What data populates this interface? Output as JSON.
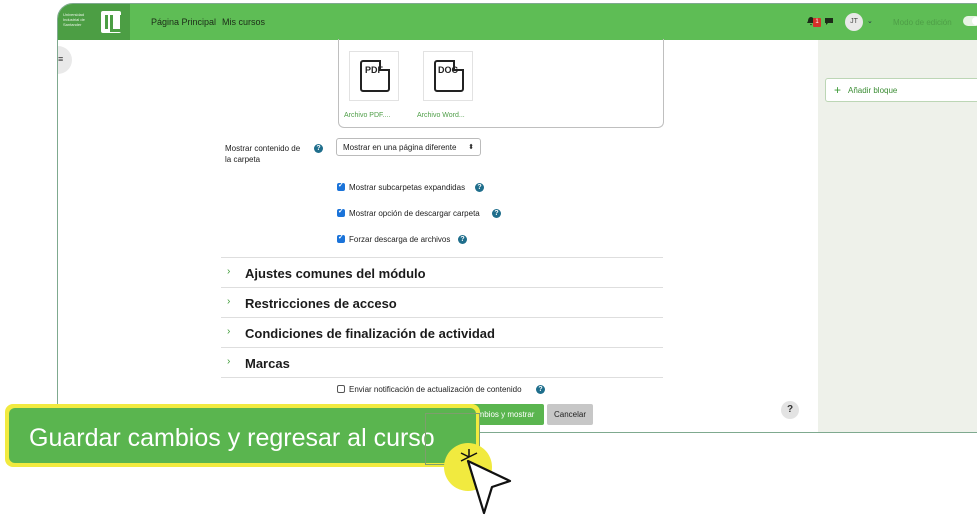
{
  "topbar": {
    "logo_text": "Universidad Industrial de Santander",
    "nav": [
      "Página Principal",
      "Mis cursos"
    ],
    "notification_count": "1",
    "avatar_initials": "JT",
    "edit_mode_label": "Modo de edición"
  },
  "files": [
    {
      "icon": "PDF",
      "name": "Archivo PDF...."
    },
    {
      "icon": "DOC",
      "name": "Archivo Word..."
    }
  ],
  "display": {
    "label": "Mostrar contenido de la carpeta",
    "select_value": "Mostrar en una página diferente"
  },
  "checkboxes": [
    {
      "label": "Mostrar subcarpetas expandidas",
      "checked": true
    },
    {
      "label": "Mostrar opción de descargar carpeta",
      "checked": true
    },
    {
      "label": "Forzar descarga de archivos",
      "checked": true
    }
  ],
  "sections": [
    "Ajustes comunes del módulo",
    "Restricciones de acceso",
    "Condiciones de finalización de actividad",
    "Marcas"
  ],
  "notify": {
    "label": "Enviar notificación de actualización de contenido",
    "checked": false
  },
  "buttons": {
    "save_show": "Guardar cambios y mostrar",
    "cancel": "Cancelar",
    "help": "?"
  },
  "sidebar": {
    "add_block": "Añadir bloque"
  },
  "callout": {
    "label": "Guardar cambios y regresar al curso"
  },
  "colors": {
    "brand_green": "#5ebd55",
    "highlight_yellow": "#f1ea3f",
    "help_blue": "#1f6e8c"
  }
}
